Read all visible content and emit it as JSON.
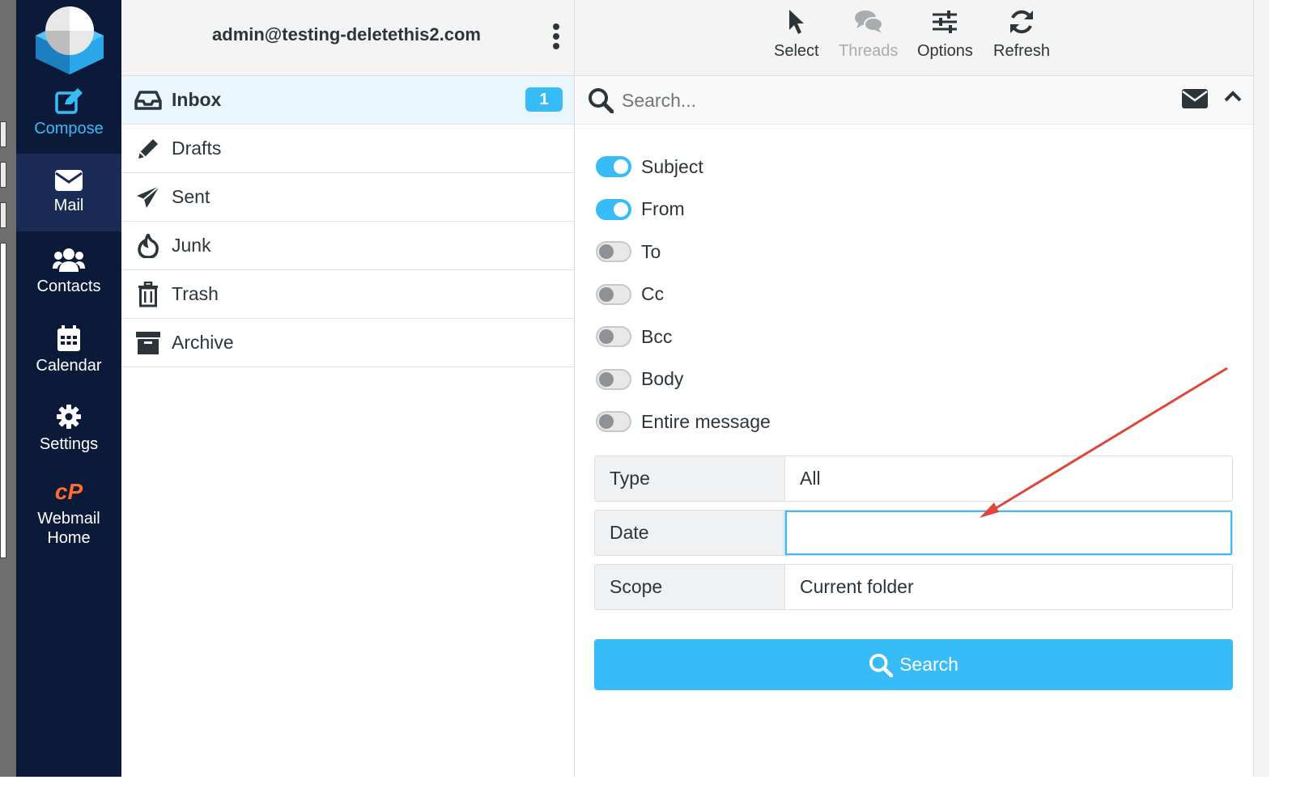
{
  "account": "admin@testing-deletethis2.com",
  "taskmenu": {
    "items": [
      {
        "label": "Compose",
        "icon": "compose-icon"
      },
      {
        "label": "Mail",
        "icon": "envelope-icon"
      },
      {
        "label": "Contacts",
        "icon": "users-icon"
      },
      {
        "label": "Calendar",
        "icon": "calendar-icon"
      },
      {
        "label": "Settings",
        "icon": "gear-icon"
      },
      {
        "label_line1": "Webmail",
        "label_line2": "Home",
        "icon": "cpanel-icon"
      }
    ]
  },
  "folders": [
    {
      "label": "Inbox",
      "icon": "inbox-icon",
      "unread": "1"
    },
    {
      "label": "Drafts",
      "icon": "pencil-icon"
    },
    {
      "label": "Sent",
      "icon": "paper-plane-icon"
    },
    {
      "label": "Junk",
      "icon": "fire-icon"
    },
    {
      "label": "Trash",
      "icon": "trash-icon"
    },
    {
      "label": "Archive",
      "icon": "archive-icon"
    }
  ],
  "toolbar": {
    "select": "Select",
    "threads": "Threads",
    "options": "Options",
    "refresh": "Refresh"
  },
  "search": {
    "placeholder": "Search...",
    "options": [
      {
        "label": "Subject",
        "on": true
      },
      {
        "label": "From",
        "on": true
      },
      {
        "label": "To",
        "on": false
      },
      {
        "label": "Cc",
        "on": false
      },
      {
        "label": "Bcc",
        "on": false
      },
      {
        "label": "Body",
        "on": false
      },
      {
        "label": "Entire message",
        "on": false
      }
    ],
    "type_label": "Type",
    "type_value": "All",
    "date_label": "Date",
    "date_value": "",
    "scope_label": "Scope",
    "scope_value": "Current folder",
    "button": "Search"
  },
  "colors": {
    "accent": "#37bcf8",
    "taskmenu_bg": "#0c1a3a",
    "annotation_arrow": "#e0473a"
  }
}
